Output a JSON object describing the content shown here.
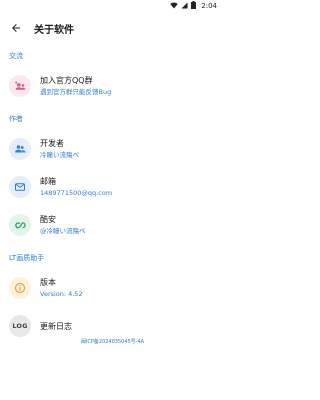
{
  "status": {
    "time": "2:04"
  },
  "header": {
    "title": "关于软件"
  },
  "sections": {
    "exchange": {
      "label": "交流",
      "qq_group": {
        "title": "加入官方QQ群",
        "subtitle": "遇到官方群只能反馈Bug"
      }
    },
    "author": {
      "label": "作者",
      "developer": {
        "title": "开发者",
        "subtitle": "冷瞳い流殤ぺ"
      },
      "email": {
        "title": "邮箱",
        "subtitle": "1489771500@qq.com"
      },
      "coolapk": {
        "title": "酷安",
        "subtitle": "@冷瞳い流殤ぺ"
      }
    },
    "app": {
      "label": "LT画质助手",
      "version": {
        "title": "版本",
        "subtitle": "Version: 4.52"
      },
      "changelog": {
        "title": "更新日志",
        "icon_text": "LOG"
      }
    }
  },
  "footer": {
    "icp": "闽ICP备2024035045号-4A"
  },
  "colors": {
    "accent": "#2f7fd6",
    "qq_bg": "#fde8ef",
    "blue_bg": "#e6eefb",
    "green_bg": "#e3f4ea",
    "amber_bg": "#fdf1dc",
    "log_bg": "#e8e8e8"
  }
}
